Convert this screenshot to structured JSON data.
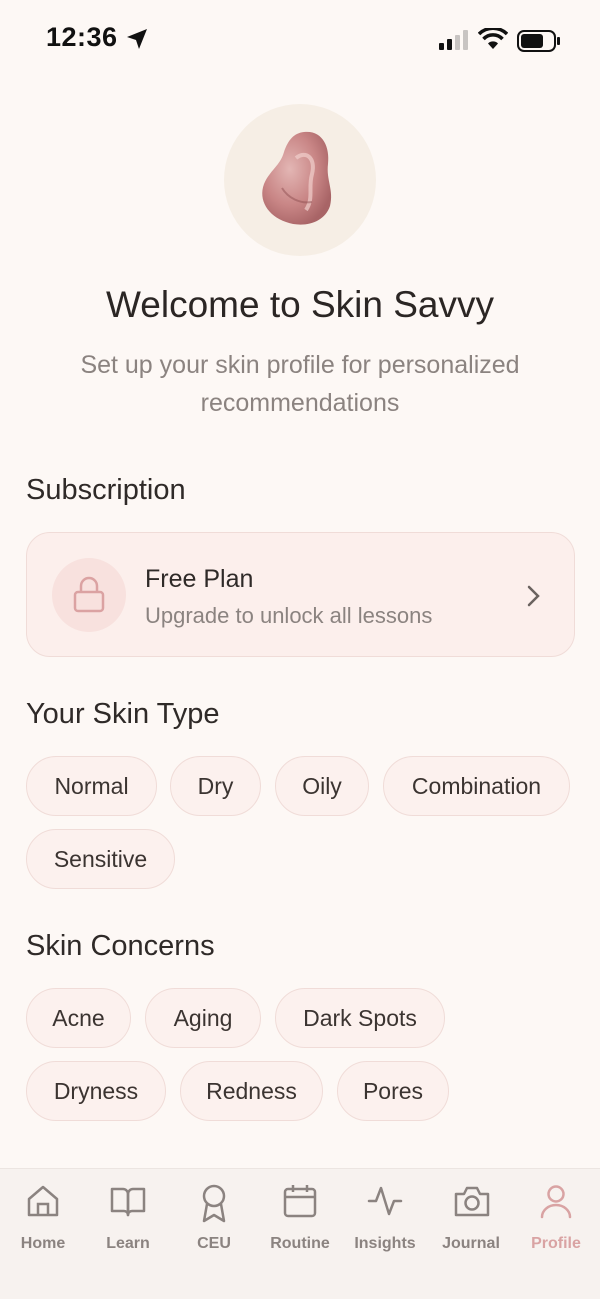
{
  "status": {
    "time": "12:36"
  },
  "welcome": {
    "title": "Welcome to Skin Savvy",
    "subtitle_line1": "Set up your skin profile for personalized",
    "subtitle_line2": "recommendations"
  },
  "subscription": {
    "heading": "Subscription",
    "plan_name": "Free Plan",
    "plan_desc": "Upgrade to unlock all lessons"
  },
  "skin_type": {
    "heading": "Your Skin Type",
    "options": [
      "Normal",
      "Dry",
      "Oily",
      "Combination",
      "Sensitive"
    ]
  },
  "skin_concerns": {
    "heading": "Skin Concerns",
    "options": [
      "Acne",
      "Aging",
      "Dark Spots",
      "Dryness",
      "Redness",
      "Pores"
    ]
  },
  "tabs": [
    "Home",
    "Learn",
    "CEU",
    "Routine",
    "Insights",
    "Journal",
    "Profile"
  ],
  "active_tab": "Profile",
  "colors": {
    "accent": "#d9a3a3",
    "background": "#fdf8f5",
    "chip_border": "#f0dcd8"
  }
}
